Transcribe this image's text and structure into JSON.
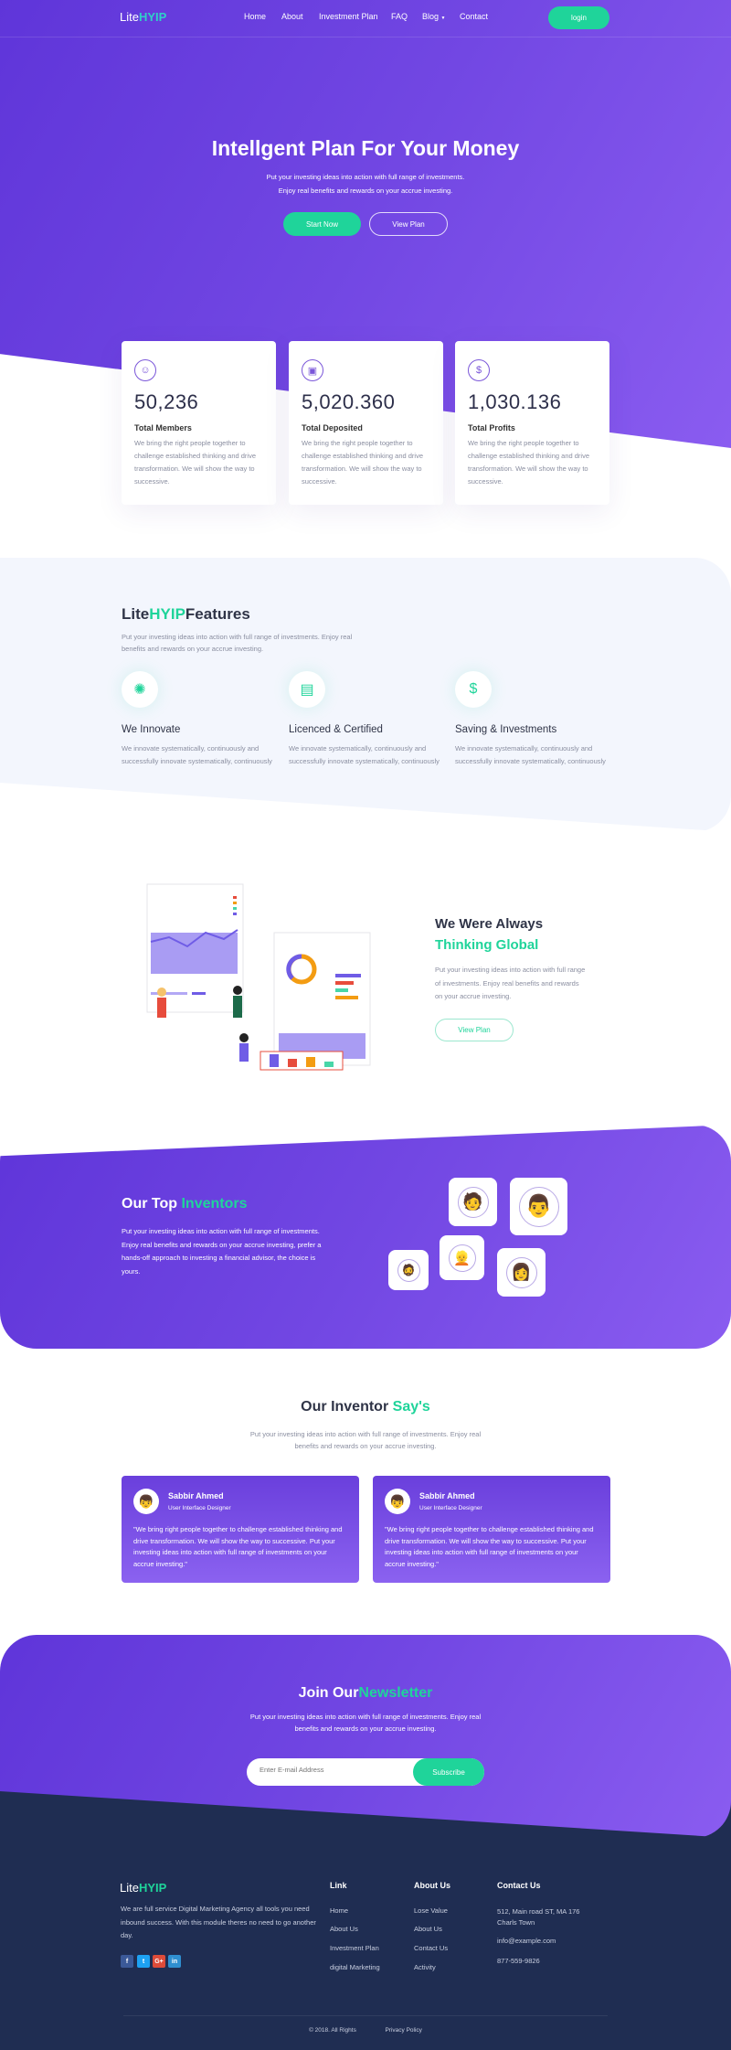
{
  "colors": {
    "primary": "#6a3fdc",
    "accent": "#1fd49a",
    "footer": "#1f2d52"
  },
  "nav": {
    "logo_a": "Lite",
    "logo_b": "HYIP",
    "items": [
      "Home",
      "About",
      "Investment Plan",
      "FAQ",
      "Blog",
      "Contact"
    ],
    "login": "login"
  },
  "hero": {
    "title": "Intellgent Plan For Your Money",
    "sub1": "Put your investing ideas into action with full range of investments.",
    "sub2": "Enjoy real benefits and rewards on your accrue investing.",
    "start": "Start Now",
    "view": "View Plan"
  },
  "stats": [
    {
      "icon": "users-icon",
      "value": "50,236",
      "label": "Total Members",
      "text": "We bring the right people together to challenge established thinking and drive transformation. We will show the way to successive."
    },
    {
      "icon": "deposit-icon",
      "value": "5,020.360",
      "label": "Total Deposited",
      "text": "We bring the right people together to challenge established thinking and drive transformation. We will show the way to successive."
    },
    {
      "icon": "profit-icon",
      "value": "1,030.136",
      "label": "Total Profits",
      "text": "We bring the right people together to challenge established thinking and drive transformation. We will show the way to successive."
    }
  ],
  "features": {
    "title_a": "Lite",
    "title_b": "HYIP",
    "title_c": "Features",
    "sub": "Put your investing ideas into action with full range of investments. Enjoy real benefits and rewards on your accrue investing.",
    "items": [
      {
        "icon": "lightbulb-icon",
        "title": "We Innovate",
        "text": "We innovate systematically, continuously and successfully innovate systematically, continuously"
      },
      {
        "icon": "certificate-icon",
        "title": "Licenced & Certified",
        "text": "We innovate systematically, continuously and successfully innovate systematically, continuously"
      },
      {
        "icon": "money-hand-icon",
        "title": "Saving & Investments",
        "text": "We innovate systematically, continuously and successfully innovate systematically, continuously"
      }
    ]
  },
  "global": {
    "title1": "We Were Always",
    "title2": "Thinking Global",
    "text": "Put your investing ideas into action with full range of investments. Enjoy real benefits and rewards on your accrue investing.",
    "button": "View Plan"
  },
  "inventors": {
    "title_a": "Our Top",
    "title_b": "Inventors",
    "text": "Put your investing ideas into action with full range of investments. Enjoy real benefits and rewards on your accrue investing, prefer a hands-off approach to investing a financial advisor, the choice is yours."
  },
  "says": {
    "title_a": "Our Inventor",
    "title_b": "Say's",
    "sub": "Put your investing ideas into action with full range of investments. Enjoy real benefits and rewards on your accrue investing.",
    "items": [
      {
        "name": "Sabbir Ahmed",
        "role": "User Interface Designer",
        "quote": "\"We bring right people together to challenge established thinking and drive transformation. We will show the way to successive. Put your investing ideas into action with full range of investments on your accrue investing.\""
      },
      {
        "name": "Sabbir Ahmed",
        "role": "User Interface Designer",
        "quote": "\"We bring right people together to challenge established thinking and drive transformation. We will show the way to successive. Put your investing ideas into action with full range of investments on your accrue investing.\""
      }
    ]
  },
  "newsletter": {
    "title_a": "Join Our",
    "title_b": "Newsletter",
    "sub": "Put your investing ideas into action with full range of investments. Enjoy real benefits and rewards on your accrue investing.",
    "placeholder": "Enter E-mail Address",
    "button": "Subscribe"
  },
  "footer": {
    "logo_a": "Lite",
    "logo_b": "HYIP",
    "about": "We are full service Digital Marketing Agency all tools you need inbound success. With this module theres no need to go another day.",
    "link_title": "Link",
    "links": [
      "Home",
      "About Us",
      "Investment Plan",
      "digital Marketing"
    ],
    "about_title": "About Us",
    "about_links": [
      "Lose Value",
      "About Us",
      "Contact Us",
      "Activity"
    ],
    "contact_title": "Contact Us",
    "address": "512, Main road ST, MA 176 Charls Town",
    "email": "info@example.com",
    "phone": "877-559-9826",
    "copyright": "© 2018. All Rights",
    "privacy": "Privacy Policy"
  }
}
